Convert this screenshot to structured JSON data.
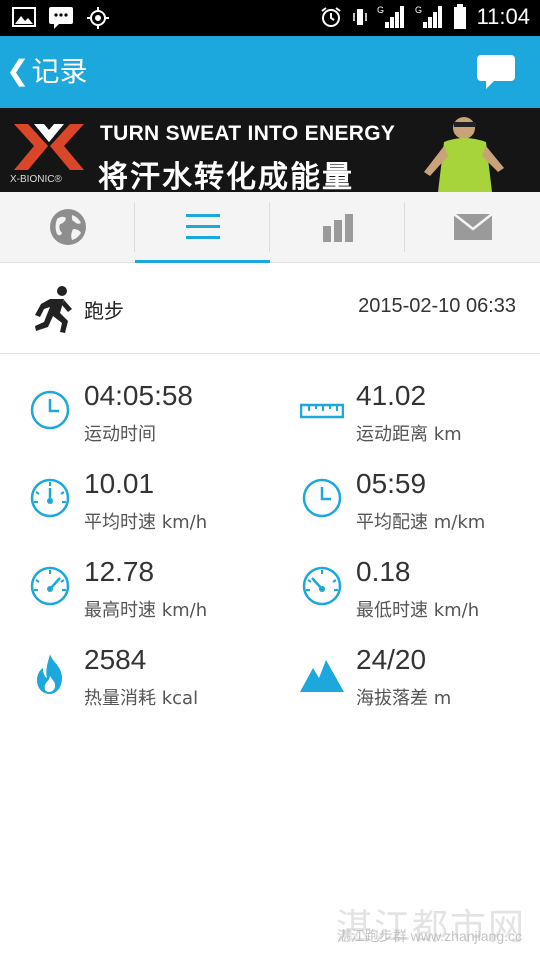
{
  "status_bar": {
    "time": "11:04",
    "icons": [
      "image-icon",
      "message-icon",
      "gps-icon",
      "alarm-icon",
      "vibrate-icon",
      "signal-g-icon",
      "signal-g-icon",
      "battery-icon"
    ]
  },
  "header": {
    "back_chevron": "❮",
    "title": "记录",
    "action_icon": "chat-bubble-icon",
    "color": "#1ca7dd"
  },
  "banner": {
    "logo_text": "X-BIONIC®",
    "headline_en": "TURN SWEAT INTO ENERGY",
    "headline_cn": "将汗水转化成能量"
  },
  "tabs": [
    {
      "icon": "globe-icon",
      "active": false
    },
    {
      "icon": "list-icon",
      "active": true
    },
    {
      "icon": "bar-chart-icon",
      "active": false
    },
    {
      "icon": "mail-icon",
      "active": false
    }
  ],
  "activity": {
    "type": "跑步",
    "datetime": "2015-02-10 06:33"
  },
  "stats": [
    {
      "value": "04:05:58",
      "label": "运动时间",
      "icon": "clock-icon"
    },
    {
      "value": "41.02",
      "label": "运动距离 km",
      "icon": "ruler-icon"
    },
    {
      "value": "10.01",
      "label": "平均时速 km/h",
      "icon": "speedometer-icon"
    },
    {
      "value": "05:59",
      "label": "平均配速 m/km",
      "icon": "clock-icon"
    },
    {
      "value": "12.78",
      "label": "最高时速 km/h",
      "icon": "speedometer-icon"
    },
    {
      "value": "0.18",
      "label": "最低时速 km/h",
      "icon": "speedometer-icon"
    },
    {
      "value": "2584",
      "label": "热量消耗 kcal",
      "icon": "flame-icon"
    },
    {
      "value": "24/20",
      "label": "海拔落差 m",
      "icon": "mountain-icon"
    }
  ],
  "watermark": {
    "cn": "湛江都市网",
    "url": "www.zhanjiang.cc",
    "overlay": "湛江跑步群"
  }
}
